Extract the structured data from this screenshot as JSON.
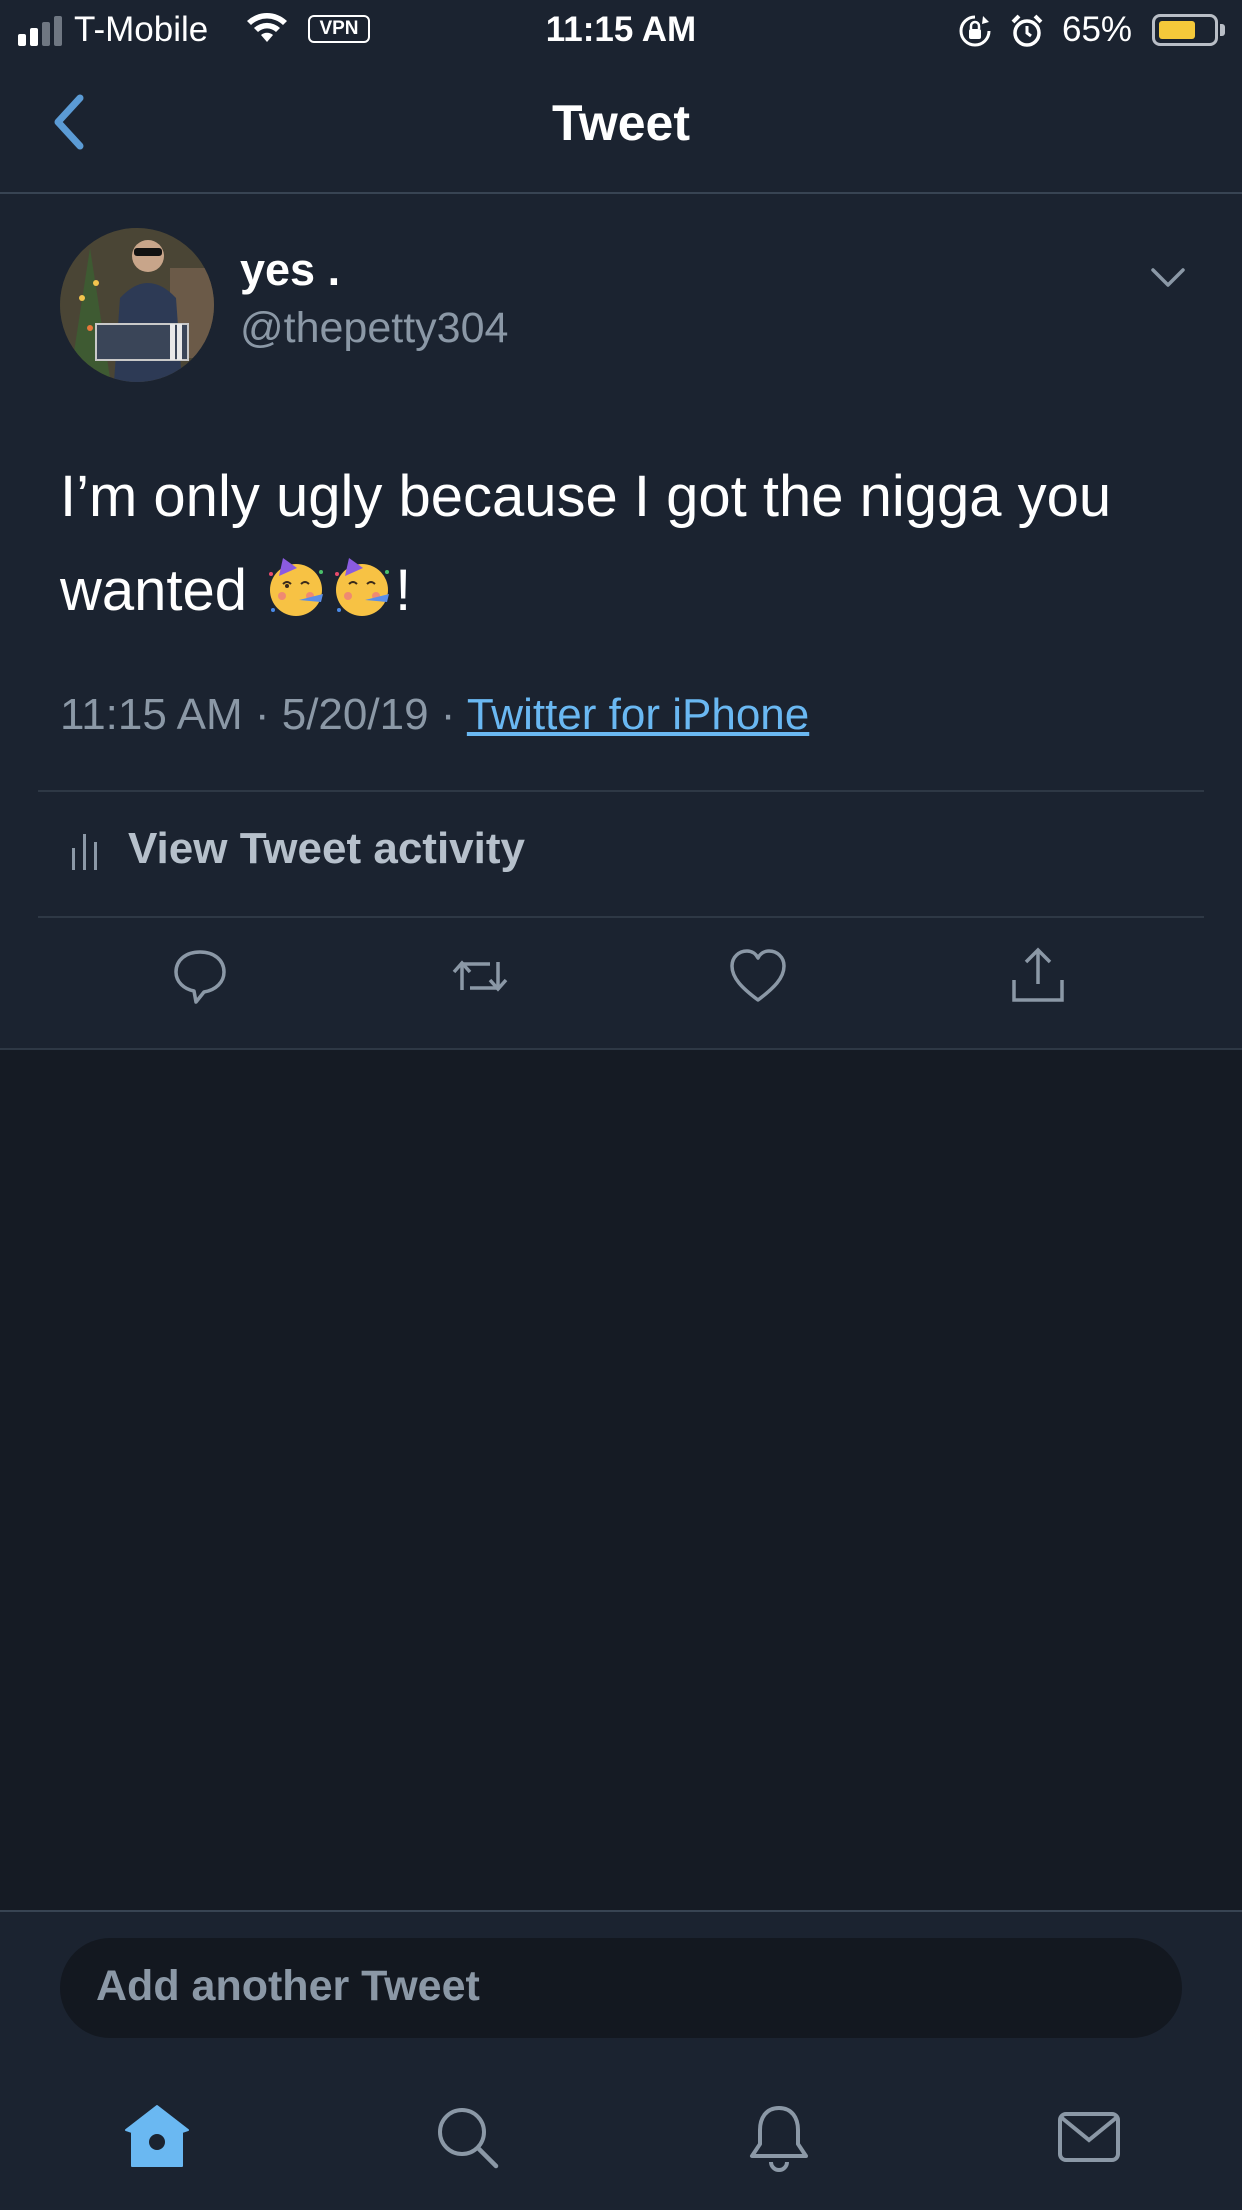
{
  "status_bar": {
    "carrier": "T-Mobile",
    "vpn_label": "VPN",
    "time": "11:15 AM",
    "battery_percent": "65%",
    "battery_level": 0.65,
    "battery_color": "#f5c93a"
  },
  "nav": {
    "title": "Tweet",
    "back_icon": "chevron-left-icon"
  },
  "tweet": {
    "display_name": "yes .",
    "handle": "@thepetty304",
    "text_main": "I’m only ugly because I got the nigga you wanted ",
    "emoji_name": "partying-face-emoji",
    "text_end": "!",
    "timestamp": "11:15 AM · 5/20/19 · ",
    "source": "Twitter for iPhone",
    "activity_label": "View Tweet activity",
    "actions": [
      "reply-icon",
      "retweet-icon",
      "like-icon",
      "share-icon"
    ]
  },
  "compose": {
    "placeholder": "Add another Tweet"
  },
  "tab_bar": {
    "tabs": [
      "home-icon",
      "search-icon",
      "notifications-icon",
      "messages-icon"
    ],
    "active_color": "#6ab8f2"
  }
}
